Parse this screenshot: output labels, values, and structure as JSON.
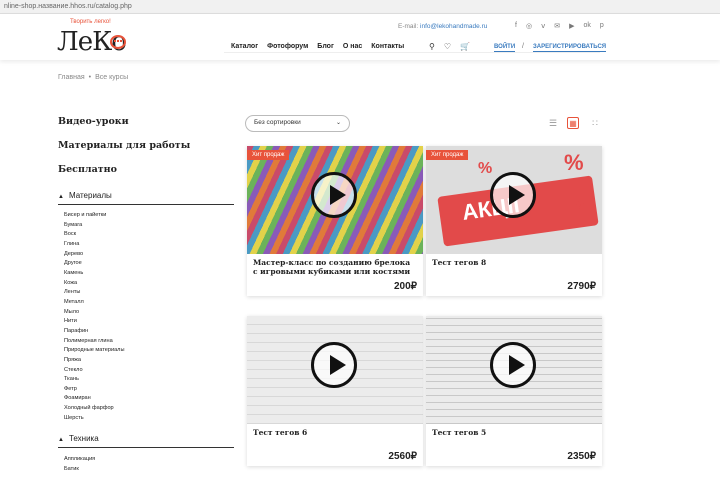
{
  "browser": {
    "url_partial": "nline-shop.название.hhos.ru/catalog.php"
  },
  "header": {
    "slogan": "Творить легко!",
    "logo_text": "ЛеКо",
    "email_label": "E-mail:",
    "email": "info@lekohandmade.ru",
    "socials": [
      "facebook-icon",
      "instagram-icon",
      "vk-icon",
      "mail-icon",
      "youtube-icon",
      "odnoklassniki-icon",
      "pinterest-icon"
    ],
    "social_glyphs": [
      "f",
      "◎",
      "ⅴ",
      "✉",
      "▶",
      "ok",
      "p"
    ],
    "nav": [
      "Каталог",
      "Фотофорум",
      "Блог",
      "О нас",
      "Контакты"
    ],
    "login": "Войти",
    "slash": "/",
    "register": "Зарегистрироваться"
  },
  "breadcrumb": {
    "home": "Главная",
    "separator": "•",
    "current": "Все курсы"
  },
  "sidebar": {
    "categories": [
      "Видео-уроки",
      "Материалы для работы",
      "Бесплатно"
    ],
    "materials_title": "Материалы",
    "materials": [
      "Бисер и пайетки",
      "Бумага",
      "Воск",
      "Глина",
      "Дерево",
      "Другое",
      "Камень",
      "Кожа",
      "Ленты",
      "Металл",
      "Мыло",
      "Нити",
      "Парафин",
      "Полимерная глина",
      "Природные материалы",
      "Пряжа",
      "Стекло",
      "Ткань",
      "Фетр",
      "Фоамиран",
      "Холодный фарфор",
      "Шерсть"
    ],
    "technique_title": "Техника",
    "techniques": [
      "Аппликация",
      "Батик"
    ]
  },
  "toolbar": {
    "sort_label": "Без сортировки"
  },
  "products": [
    {
      "title": "Мастер-класс по созданию брелока с игровыми кубиками или костями",
      "price": "200₽",
      "badge": "Хит продаж"
    },
    {
      "title": "Тест тегов 8",
      "price": "2790₽",
      "badge": "Хит продаж",
      "image_text": "АКЦІЇ",
      "image_marks": "%"
    },
    {
      "title": "Тест тегов 6",
      "price": "2560₽",
      "badge": ""
    },
    {
      "title": "Тест тегов 5",
      "price": "2350₽",
      "badge": ""
    }
  ],
  "colors": {
    "accent": "#e8533a",
    "link": "#3a7bbf"
  }
}
